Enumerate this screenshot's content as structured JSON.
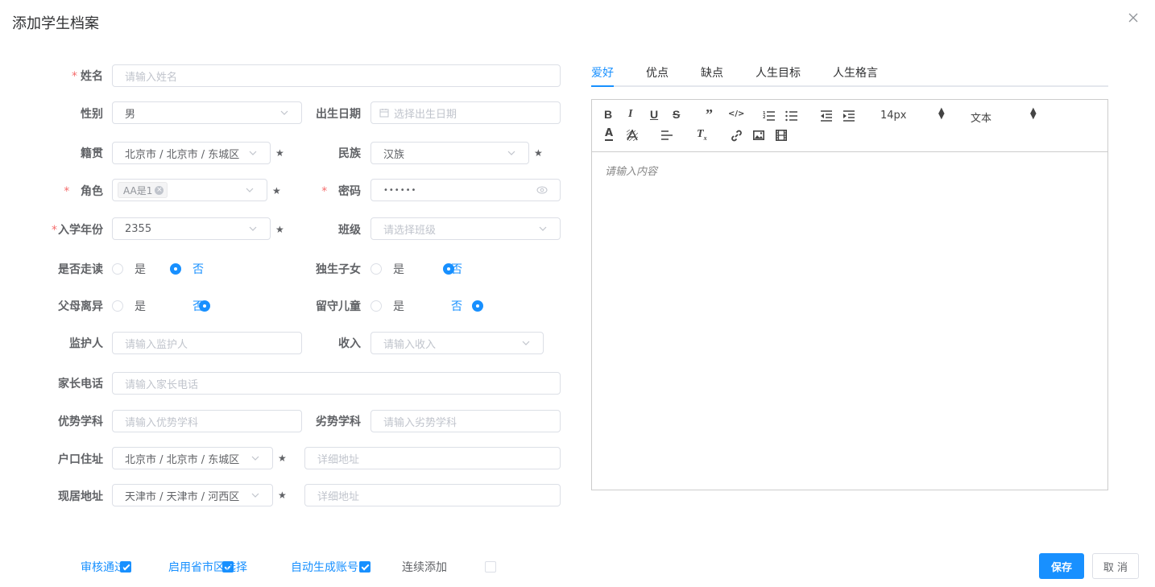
{
  "dialog": {
    "title": "添加学生档案"
  },
  "form": {
    "name": {
      "label": "姓名",
      "required": "*",
      "placeholder": "请输入姓名"
    },
    "gender": {
      "label": "性别",
      "value": "男"
    },
    "birth": {
      "label": "出生日期",
      "placeholder": "选择出生日期"
    },
    "native_place": {
      "label": "籍贯",
      "value": "北京市 / 北京市 / 东城区"
    },
    "ethnic": {
      "label": "民族",
      "value": "汉族"
    },
    "role": {
      "label": "角色",
      "required": "*",
      "tag": "AA是1"
    },
    "password": {
      "label": "密码",
      "required": "*",
      "value": "••••••"
    },
    "enroll_year": {
      "label": "入学年份",
      "required": "*",
      "value": "2355"
    },
    "class": {
      "label": "班级",
      "placeholder": "请选择班级"
    },
    "boarding": {
      "label": "是否走读",
      "yes": "是",
      "no": "否",
      "selected": "否"
    },
    "only_child": {
      "label": "独生子女",
      "yes": "是",
      "no": "否",
      "selected": "否"
    },
    "parents_divorced": {
      "label": "父母离异",
      "yes": "是",
      "no": "否",
      "selected": "否"
    },
    "left_behind": {
      "label": "留守儿童",
      "yes": "是",
      "no": "否",
      "selected": "否"
    },
    "guardian": {
      "label": "监护人",
      "placeholder": "请输入监护人"
    },
    "income": {
      "label": "收入",
      "placeholder": "请输入收入"
    },
    "parent_phone": {
      "label": "家长电话",
      "placeholder": "请输入家长电话"
    },
    "strong_subject": {
      "label": "优势学科",
      "placeholder": "请输入优势学科"
    },
    "weak_subject": {
      "label": "劣势学科",
      "placeholder": "请输入劣势学科"
    },
    "hukou": {
      "label": "户口住址",
      "value": "北京市 / 北京市 / 东城区",
      "detail_placeholder": "详细地址"
    },
    "current_address": {
      "label": "现居地址",
      "value": "天津市 / 天津市 / 河西区",
      "detail_placeholder": "详细地址"
    },
    "star": "★"
  },
  "tabs": [
    "爱好",
    "优点",
    "缺点",
    "人生目标",
    "人生格言"
  ],
  "editor": {
    "font_size": "14px",
    "header_type": "文本",
    "placeholder": "请输入内容"
  },
  "footer": {
    "checkboxes": [
      {
        "label": "审核通过",
        "checked": true
      },
      {
        "label": "启用省市区选择",
        "checked": true
      },
      {
        "label": "自动生成账号",
        "checked": true
      },
      {
        "label": "连续添加",
        "checked": false
      }
    ],
    "save": "保存",
    "cancel": "取 消"
  },
  "colors": {
    "primary": "#1890ff",
    "required": "#f56c6c",
    "border": "#dcdfe6"
  }
}
